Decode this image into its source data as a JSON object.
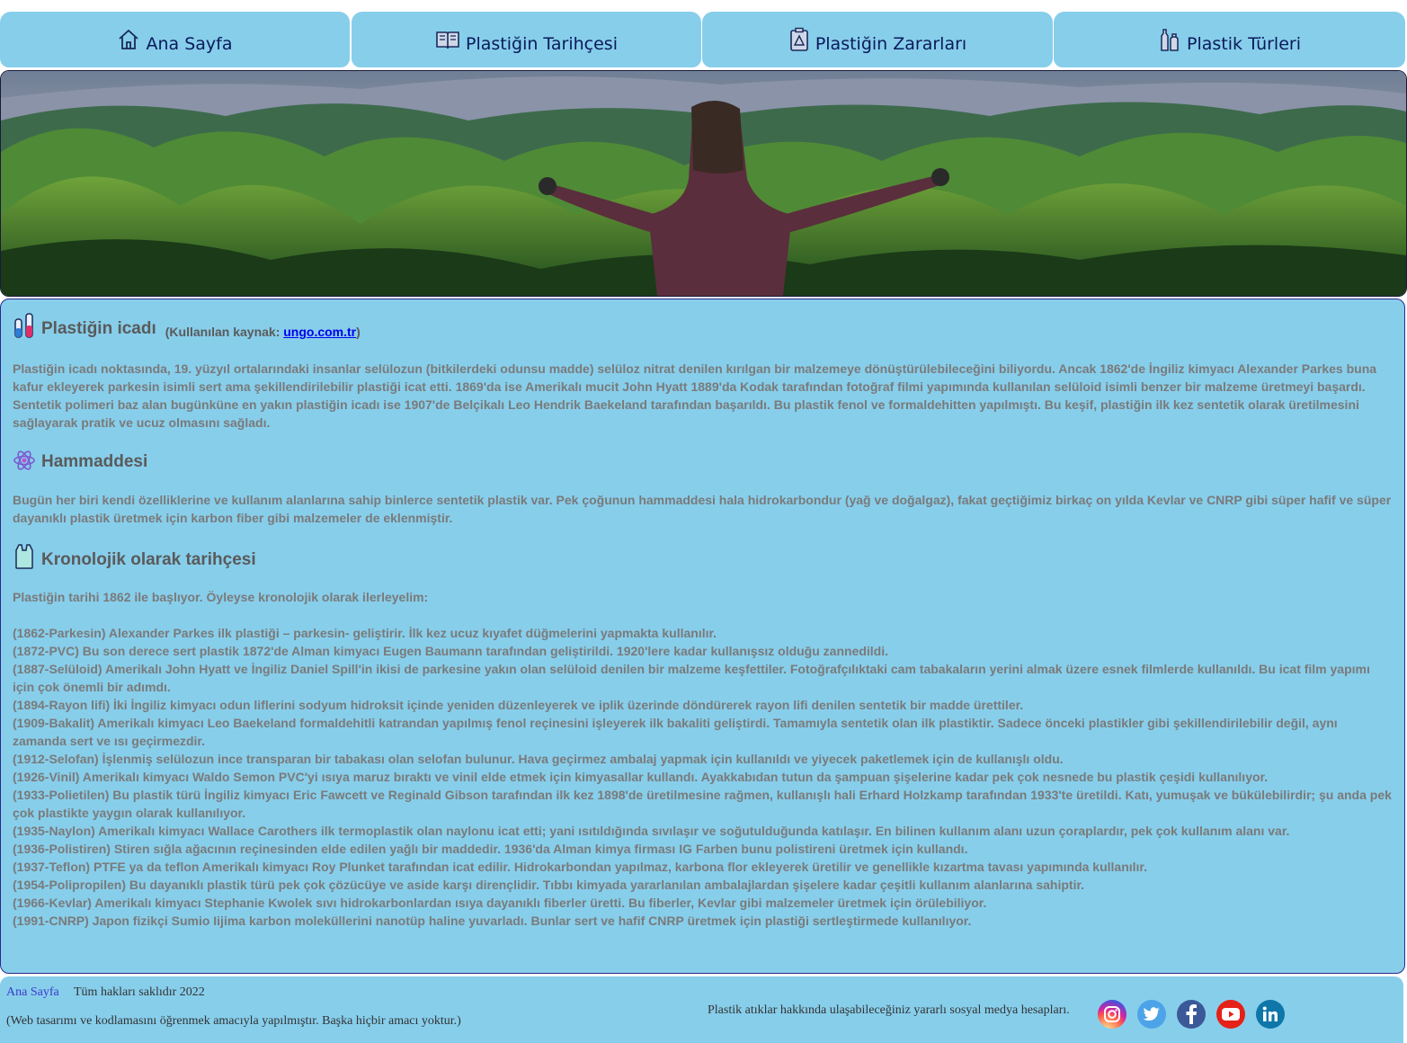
{
  "nav": [
    {
      "label": "Ana Sayfa",
      "icon": "home-icon"
    },
    {
      "label": "Plastiğin Tarihçesi",
      "icon": "book-icon"
    },
    {
      "label": "Plastiğin Zararları",
      "icon": "warning-icon"
    },
    {
      "label": "Plastik Türleri",
      "icon": "bottles-icon"
    }
  ],
  "sections": {
    "invention": {
      "title": "Plastiğin icadı",
      "source_prefix": "(Kullanılan kaynak: ",
      "source_link": "ungo.com.tr",
      "source_suffix": ")",
      "body": "Plastiğin icadı noktasında, 19. yüzyıl ortalarındaki insanlar selülozun (bitkilerdeki odunsu madde) selüloz nitrat denilen kırılgan bir malzemeye dönüştürülebileceğini biliyordu. Ancak 1862'de İngiliz kimyacı Alexander Parkes buna kafur ekleyerek parkesin isimli sert ama şekillendirilebilir plastiği icat etti. 1869'da ise Amerikalı mucit John Hyatt 1889'da Kodak tarafından fotoğraf filmi yapımında kullanılan selüloid isimli benzer bir malzeme üretmeyi başardı. Sentetik polimeri baz alan bugünküne en yakın plastiğin icadı ise 1907'de Belçikalı Leo Hendrik Baekeland tarafından başarıldı. Bu plastik fenol ve formaldehitten yapılmıştı. Bu keşif, plastiğin ilk kez sentetik olarak üretilmesini sağlayarak pratik ve ucuz olmasını sağladı."
    },
    "raw": {
      "title": "Hammaddesi",
      "body": "Bugün her biri kendi özelliklerine ve kullanım alanlarına sahip binlerce sentetik plastik var. Pek çoğunun hammaddesi hala hidrokarbondur (yağ ve doğalgaz), fakat geçtiğimiz birkaç on yılda Kevlar ve CNRP gibi süper hafif ve süper dayanıklı plastik üretmek için karbon fiber gibi malzemeler de eklenmiştir."
    },
    "chronology": {
      "title": "Kronolojik olarak tarihçesi",
      "intro": "Plastiğin tarihi 1862 ile başlıyor. Öyleyse kronolojik olarak ilerleyelim:",
      "items": [
        "(1862-Parkesin) Alexander Parkes ilk plastiği – parkesin- geliştirir. İlk kez ucuz kıyafet düğmelerini yapmakta kullanılır.",
        "(1872-PVC) Bu son derece sert plastik 1872'de Alman kimyacı Eugen Baumann tarafından geliştirildi. 1920'lere kadar kullanışsız olduğu zannedildi.",
        "(1887-Selüloid) Amerikalı John Hyatt ve İngiliz Daniel Spill'in ikisi de parkesine yakın olan selüloid denilen bir malzeme keşfettiler. Fotoğrafçılıktaki cam tabakaların yerini almak üzere esnek filmlerde kullanıldı. Bu icat film yapımı için çok önemli bir adımdı.",
        "(1894-Rayon lifi) İki İngiliz kimyacı odun liflerini sodyum hidroksit içinde yeniden düzenleyerek ve iplik üzerinde döndürerek rayon lifi denilen sentetik bir madde ürettiler.",
        "(1909-Bakalit) Amerikalı kimyacı Leo Baekeland formaldehitli katrandan yapılmış fenol reçinesini işleyerek ilk bakaliti geliştirdi. Tamamıyla sentetik olan ilk plastiktir. Sadece önceki plastikler gibi şekillendirilebilir değil, aynı zamanda sert ve ısı geçirmezdir.",
        "(1912-Selofan) İşlenmiş selülozun ince transparan bir tabakası olan selofan bulunur. Hava geçirmez ambalaj yapmak için kullanıldı ve yiyecek paketlemek için de kullanışlı oldu.",
        "(1926-Vinil) Amerikalı kimyacı Waldo Semon PVC'yi ısıya maruz bıraktı ve vinil elde etmek için kimyasallar kullandı. Ayakkabıdan tutun da şampuan şişelerine kadar pek çok nesnede bu plastik çeşidi kullanılıyor.",
        "(1933-Polietilen) Bu plastik türü İngiliz kimyacı Eric Fawcett ve Reginald Gibson tarafından ilk kez 1898'de üretilmesine rağmen, kullanışlı hali Erhard Holzkamp tarafından 1933'te üretildi. Katı, yumuşak ve bükülebilirdir; şu anda pek çok plastikte yaygın olarak kullanılıyor.",
        "(1935-Naylon) Amerikalı kimyacı Wallace Carothers ilk termoplastik olan naylonu icat etti; yani ısıtıldığında sıvılaşır ve soğutulduğunda katılaşır. En bilinen kullanım alanı uzun çoraplardır, pek çok kullanım alanı var.",
        "(1936-Polistiren) Stiren sığla ağacının reçinesinden elde edilen yağlı bir maddedir. 1936'da Alman kimya firması IG Farben bunu polistireni üretmek için kullandı.",
        "(1937-Teflon) PTFE ya da teflon Amerikalı kimyacı Roy Plunket tarafından icat edilir. Hidrokarbondan yapılmaz, karbona flor ekleyerek üretilir ve genellikle kızartma tavası yapımında kullanılır.",
        "(1954-Polipropilen) Bu dayanıklı plastik türü pek çok çözücüye ve aside karşı dirençlidir. Tıbbı kimyada yararlanılan ambalajlardan şişelere kadar çeşitli kullanım alanlarına sahiptir.",
        "(1966-Kevlar) Amerikalı kimyacı Stephanie Kwolek sıvı hidrokarbonlardan ısıya dayanıklı fiberler üretti. Bu fiberler, Kevlar gibi malzemeler üretmek için örülebiliyor.",
        "(1991-CNRP) Japon fizikçi Sumio Iijima karbon moleküllerini nanotüp haline yuvarladı. Bunlar sert ve hafif CNRP üretmek için plastiği sertleştirmede kullanılıyor."
      ]
    }
  },
  "footer": {
    "home_link": "Ana Sayfa",
    "rights": "Tüm hakları saklıdır 2022",
    "note": "(Web tasarımı ve kodlamasını öğrenmek amacıyla yapılmıştır. Başka hiçbir amacı yoktur.)",
    "social_text": "Plastik atıklar hakkında ulaşabileceğiniz yararlı sosyal medya hesapları.",
    "social_icons": [
      "instagram-icon",
      "twitter-icon",
      "facebook-icon",
      "youtube-icon",
      "linkedin-icon"
    ]
  },
  "colors": {
    "panel": "#87ceeb",
    "nav_text": "#0a1a5a",
    "body_text": "#7a7a7a",
    "link": "#0000ee"
  }
}
